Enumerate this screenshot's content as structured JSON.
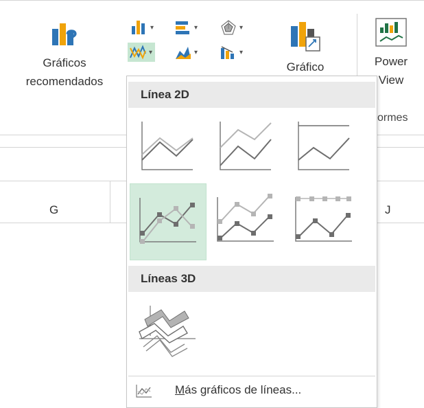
{
  "ribbon": {
    "recommended_label_1": "Gráficos",
    "recommended_label_2": "recomendados",
    "chart_label_partial": "Gráfico",
    "power_view_label_1": "Power",
    "power_view_label_2": "View",
    "reports_group_label": "ormes"
  },
  "columns": {
    "g": "G",
    "j": "J"
  },
  "menu": {
    "section_2d": "Línea 2D",
    "section_3d": "Líneas 3D",
    "tiles_2d": [
      "Línea",
      "Línea apilada",
      "Línea 100% apilada",
      "Línea con marcadores",
      "Línea apilada con marcadores",
      "Línea 100% apilada con marcadores"
    ],
    "tiles_3d": [
      "Línea 3D"
    ],
    "selected_tile": "Línea con marcadores",
    "more_prefix": "M",
    "more_rest": "ás gráficos de líneas..."
  },
  "colors": {
    "accent_green": "#217346",
    "selected_bg": "#d3ebdc",
    "section_bg": "#eaeaea"
  }
}
